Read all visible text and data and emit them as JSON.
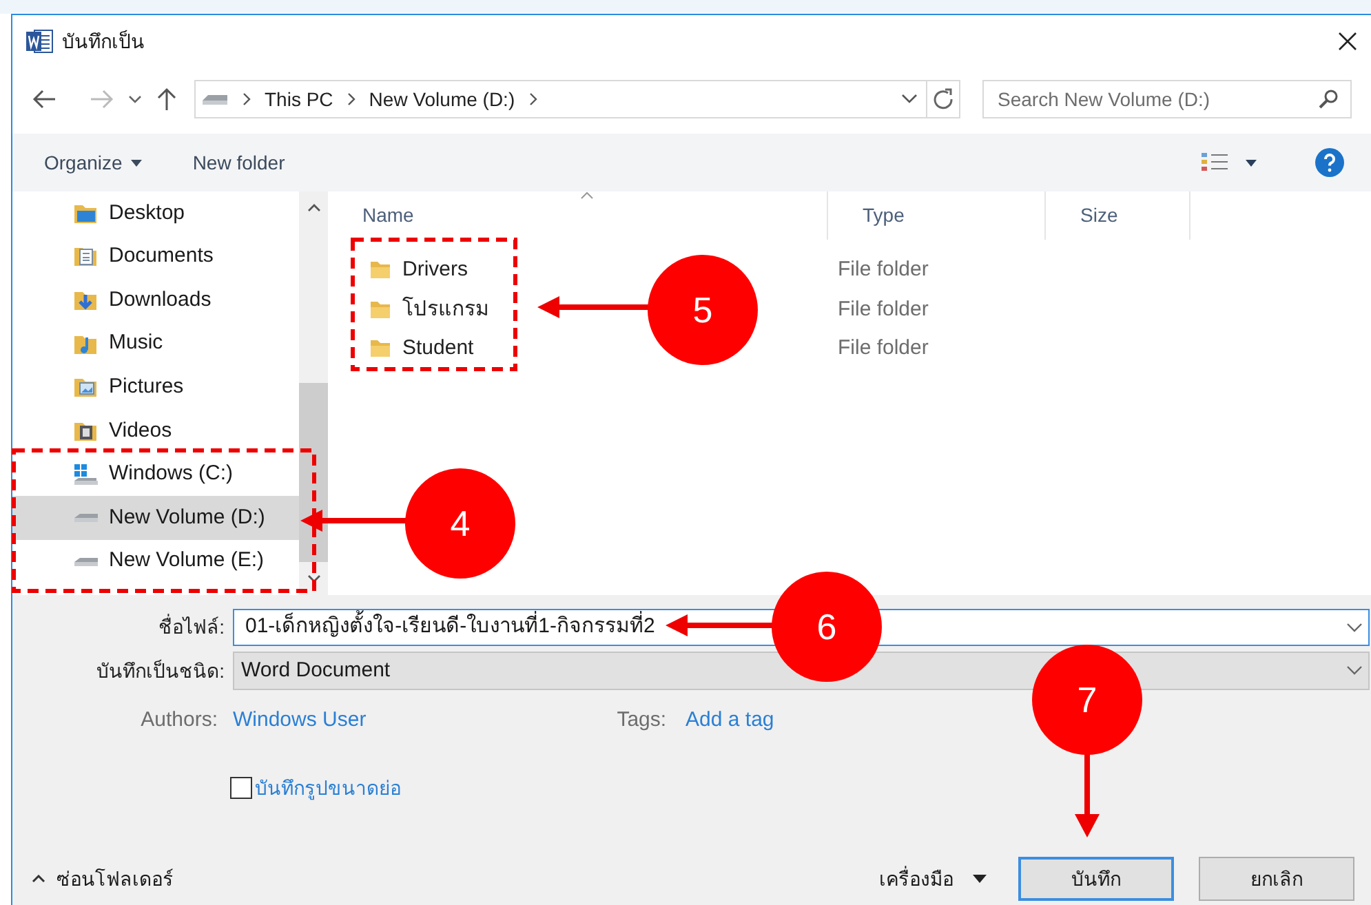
{
  "window": {
    "title": "บันทึกเป็น"
  },
  "address_bar": {
    "path": [
      "This PC",
      "New Volume (D:)"
    ]
  },
  "search": {
    "placeholder": "Search New Volume (D:)"
  },
  "toolbar": {
    "organize": "Organize",
    "new_folder": "New folder"
  },
  "sidebar": {
    "items": [
      {
        "label": "Desktop",
        "kind": "folder-blue",
        "selected": false
      },
      {
        "label": "Documents",
        "kind": "documents",
        "selected": false
      },
      {
        "label": "Downloads",
        "kind": "downloads",
        "selected": false
      },
      {
        "label": "Music",
        "kind": "music",
        "selected": false
      },
      {
        "label": "Pictures",
        "kind": "pictures",
        "selected": false
      },
      {
        "label": "Videos",
        "kind": "videos",
        "selected": false
      },
      {
        "label": "Windows (C:)",
        "kind": "windows-drive",
        "selected": false
      },
      {
        "label": "New Volume (D:)",
        "kind": "drive",
        "selected": true
      },
      {
        "label": "New Volume (E:)",
        "kind": "drive",
        "selected": false
      }
    ]
  },
  "table": {
    "columns": [
      "Name",
      "Type",
      "Size"
    ],
    "rows": [
      {
        "name": "Drivers",
        "type": "File folder"
      },
      {
        "name": "โปรแกรม",
        "type": "File folder"
      },
      {
        "name": "Student",
        "type": "File folder"
      }
    ]
  },
  "form": {
    "file_name_label": "ชื่อไฟล์:",
    "file_name": "01-เด็กหญิงตั้งใจ-เรียนดี-ใบงานที่1-กิจกรรมที่2",
    "save_type_label": "บันทึกเป็นชนิด:",
    "save_type": "Word Document",
    "authors_label": "Authors:",
    "authors": "Windows User",
    "tags_label": "Tags:",
    "tags": "Add a tag",
    "thumbnail": {
      "label": "บันทึกรูปขนาดย่อ",
      "checked": false
    }
  },
  "footer": {
    "hide_folders": "ซ่อนโฟลเดอร์",
    "tools": "เครื่องมือ",
    "save": "บันทึก",
    "cancel": "ยกเลิก"
  },
  "annotations": [
    {
      "label": "5"
    },
    {
      "label": "4"
    },
    {
      "label": "6"
    },
    {
      "label": "7"
    }
  ]
}
